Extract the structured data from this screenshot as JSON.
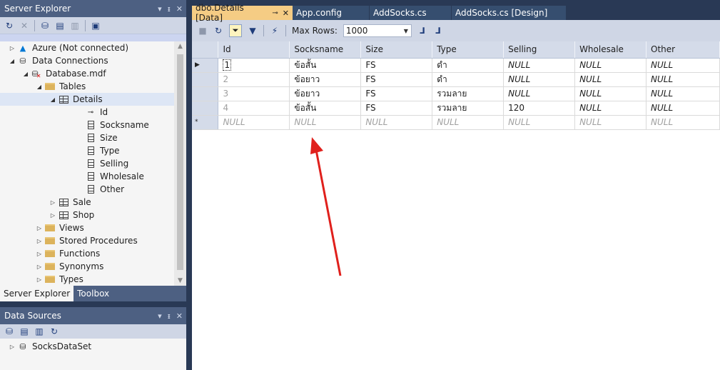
{
  "server_explorer": {
    "title": "Server Explorer",
    "tree": [
      {
        "label": "Azure (Not connected)",
        "icon": "azure-icon",
        "level": 0,
        "expander": "▷"
      },
      {
        "label": "Data Connections",
        "icon": "data-connections-icon",
        "level": 0,
        "expander": "◢"
      },
      {
        "label": "Database.mdf",
        "icon": "database-disconnected-icon",
        "level": 1,
        "expander": "◢"
      },
      {
        "label": "Tables",
        "icon": "folder-icon",
        "level": 2,
        "expander": "◢"
      },
      {
        "label": "Details",
        "icon": "table-icon",
        "level": 3,
        "expander": "◢",
        "selected": true
      },
      {
        "label": "Id",
        "icon": "primary-key-icon",
        "level": 5,
        "expander": ""
      },
      {
        "label": "Socksname",
        "icon": "column-icon",
        "level": 5,
        "expander": ""
      },
      {
        "label": "Size",
        "icon": "column-icon",
        "level": 5,
        "expander": ""
      },
      {
        "label": "Type",
        "icon": "column-icon",
        "level": 5,
        "expander": ""
      },
      {
        "label": "Selling",
        "icon": "column-icon",
        "level": 5,
        "expander": ""
      },
      {
        "label": "Wholesale",
        "icon": "column-icon",
        "level": 5,
        "expander": ""
      },
      {
        "label": "Other",
        "icon": "column-icon",
        "level": 5,
        "expander": ""
      },
      {
        "label": "Sale",
        "icon": "table-icon",
        "level": 3,
        "expander": "▷"
      },
      {
        "label": "Shop",
        "icon": "table-icon",
        "level": 3,
        "expander": "▷"
      },
      {
        "label": "Views",
        "icon": "folder-icon",
        "level": 2,
        "expander": "▷"
      },
      {
        "label": "Stored Procedures",
        "icon": "folder-icon",
        "level": 2,
        "expander": "▷"
      },
      {
        "label": "Functions",
        "icon": "folder-icon",
        "level": 2,
        "expander": "▷"
      },
      {
        "label": "Synonyms",
        "icon": "folder-icon",
        "level": 2,
        "expander": "▷"
      },
      {
        "label": "Types",
        "icon": "folder-icon",
        "level": 2,
        "expander": "▷"
      }
    ]
  },
  "bottom_tabs": [
    "Server Explorer",
    "Toolbox"
  ],
  "data_sources": {
    "title": "Data Sources",
    "items": [
      {
        "label": "SocksDataSet",
        "expander": "▷"
      }
    ]
  },
  "doc_tabs": [
    {
      "label": "dbo.Details [Data]",
      "active": true
    },
    {
      "label": "App.config",
      "active": false
    },
    {
      "label": "AddSocks.cs",
      "active": false
    },
    {
      "label": "AddSocks.cs [Design]",
      "active": false
    }
  ],
  "editor_toolbar": {
    "max_rows_label": "Max Rows:",
    "max_rows_value": "1000"
  },
  "grid": {
    "columns": [
      "Id",
      "Socksname",
      "Size",
      "Type",
      "Selling",
      "Wholesale",
      "Other"
    ],
    "rows": [
      {
        "marker": "▶",
        "cells": [
          "1",
          "ข้อสั้น",
          "FS",
          "ดำ",
          "NULL",
          "NULL",
          "NULL"
        ]
      },
      {
        "marker": "",
        "cells": [
          "2",
          "ข้อยาว",
          "FS",
          "ดำ",
          "NULL",
          "NULL",
          "NULL"
        ]
      },
      {
        "marker": "",
        "cells": [
          "3",
          "ข้อยาว",
          "FS",
          "รวมลาย",
          "NULL",
          "NULL",
          "NULL"
        ]
      },
      {
        "marker": "",
        "cells": [
          "4",
          "ข้อสั้น",
          "FS",
          "รวมลาย",
          "120",
          "NULL",
          "NULL"
        ]
      },
      {
        "marker": "*",
        "cells": [
          "NULL",
          "NULL",
          "NULL",
          "NULL",
          "NULL",
          "NULL",
          "NULL"
        ]
      }
    ]
  },
  "colors": {
    "accent_tab": "#f5cc84",
    "arrow": "#e0201c",
    "frame": "#293955"
  }
}
